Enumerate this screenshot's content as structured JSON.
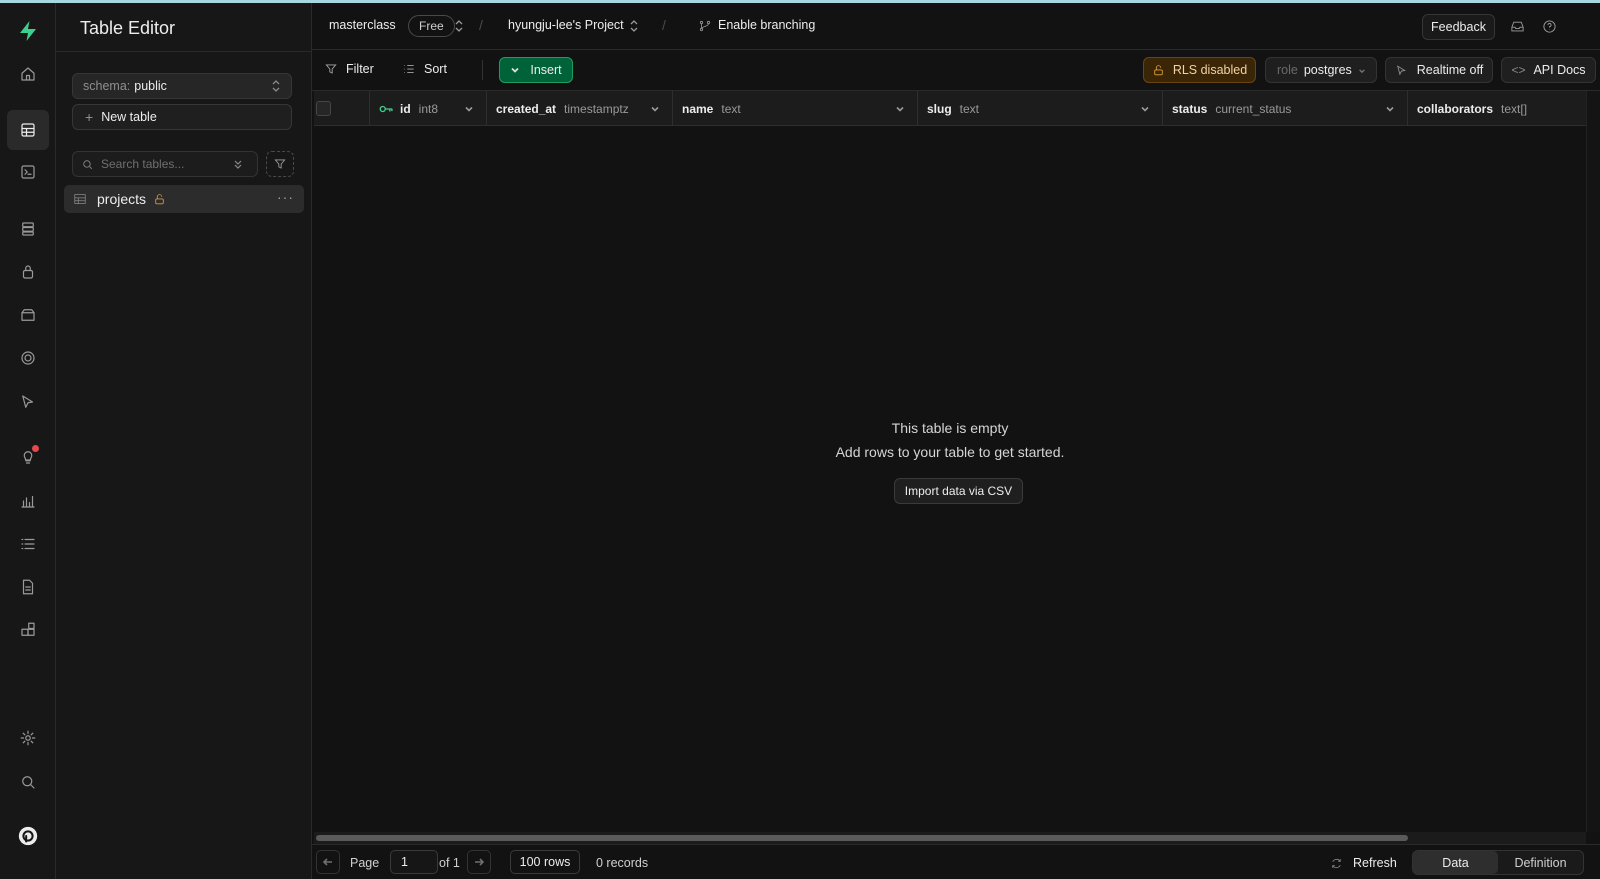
{
  "app": {
    "page_title": "Table Editor"
  },
  "header": {
    "org": "masterclass",
    "plan_badge": "Free",
    "project": "hyungju-lee's Project",
    "branching": "Enable branching",
    "feedback": "Feedback"
  },
  "sidebar": {
    "schema_label": "schema:",
    "schema_value": "public",
    "new_table": "New table",
    "search_placeholder": "Search tables...",
    "tables": [
      {
        "name": "projects",
        "rls_locked": true
      }
    ]
  },
  "toolbar": {
    "filter": "Filter",
    "sort": "Sort",
    "insert": "Insert",
    "rls": "RLS disabled",
    "role_label": "role",
    "role_value": "postgres",
    "realtime": "Realtime off",
    "api_docs": "API Docs"
  },
  "grid": {
    "columns": [
      {
        "name": "id",
        "type": "int8",
        "primary_key": true
      },
      {
        "name": "created_at",
        "type": "timestamptz"
      },
      {
        "name": "name",
        "type": "text"
      },
      {
        "name": "slug",
        "type": "text"
      },
      {
        "name": "status",
        "type": "current_status"
      },
      {
        "name": "collaborators",
        "type": "text[]"
      }
    ],
    "empty_title": "This table is empty",
    "empty_subtitle": "Add rows to your table to get started.",
    "import_csv": "Import data via CSV"
  },
  "footer": {
    "page_label": "Page",
    "page_value": "1",
    "of_total": "of 1",
    "rows_per_page": "100 rows",
    "records": "0 records",
    "refresh": "Refresh",
    "view_data": "Data",
    "view_definition": "Definition"
  },
  "colors": {
    "background": "#121212",
    "brand_green": "#3ecf8e",
    "insert_green": "#006239",
    "rls_warning": "#e3a03d",
    "notification_red": "#e5484d"
  }
}
